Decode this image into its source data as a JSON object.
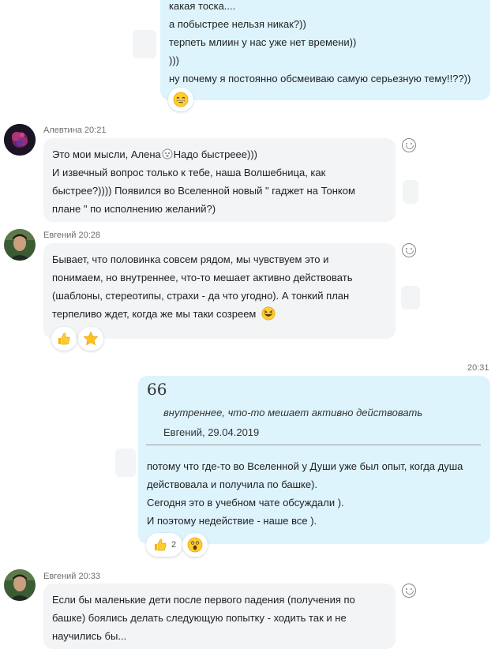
{
  "messages": [
    {
      "lines": [
        "какая тоска....",
        "а побыстрее нельзя никак?))",
        "терпеть млиин у нас уже нет времени))",
        ")))",
        "ну почему я постоянно обсмеиваю самую серьезную тему!!??))"
      ],
      "reaction_icon": "grinning-face-icon"
    },
    {
      "author": "Алевтина",
      "time": "20:21",
      "line1_a": "Это мои мысли, Алена",
      "line1_b": "Надо быстрееe)))",
      "lines": [
        "И  извечный вопрос только к тебе, наша Волшебница,  как",
        "быстрее?)))) Появился во Вселенной новый \" гаджет  на Тонком",
        "плане \" по исполнению желаний?)"
      ],
      "inline_icon": "face-icon"
    },
    {
      "author": "Евгений",
      "time": "20:28",
      "lines": [
        "Бывает, что половинка совсем рядом, мы чувствуем это и",
        "понимаем, но внутреннее, что-то мешает активно действовать",
        "(шаблоны, стереотипы, страхи - да что угодно). А тонкий план"
      ],
      "last_line": "терпеливо ждет, когда же мы таки созреем",
      "reactions": [
        "thumbs-up-icon",
        "star-icon"
      ]
    },
    {
      "time": "20:31",
      "quote": {
        "mark": "66",
        "text": "внутреннее, что-то мешает активно действовать",
        "author": "Евгений, 29.04.2019"
      },
      "lines": [
        "потому что где-то во Вселенной у Души уже был опыт, когда душа",
        "действовала и получила по башке).",
        "Сегодня это в учебном чате обсуждали ).",
        "И поэтому недействие - наше все )."
      ],
      "reactions": [
        {
          "icon": "thumbs-up-icon",
          "count": "2"
        },
        {
          "icon": "surprised-face-icon"
        }
      ]
    },
    {
      "author": "Евгений",
      "time": "20:33",
      "lines": [
        "Если бы маленькие дети после первого падения (получения по",
        "башке) боялись делать следующую попытку - ходить так и не",
        "научились бы..."
      ]
    }
  ]
}
